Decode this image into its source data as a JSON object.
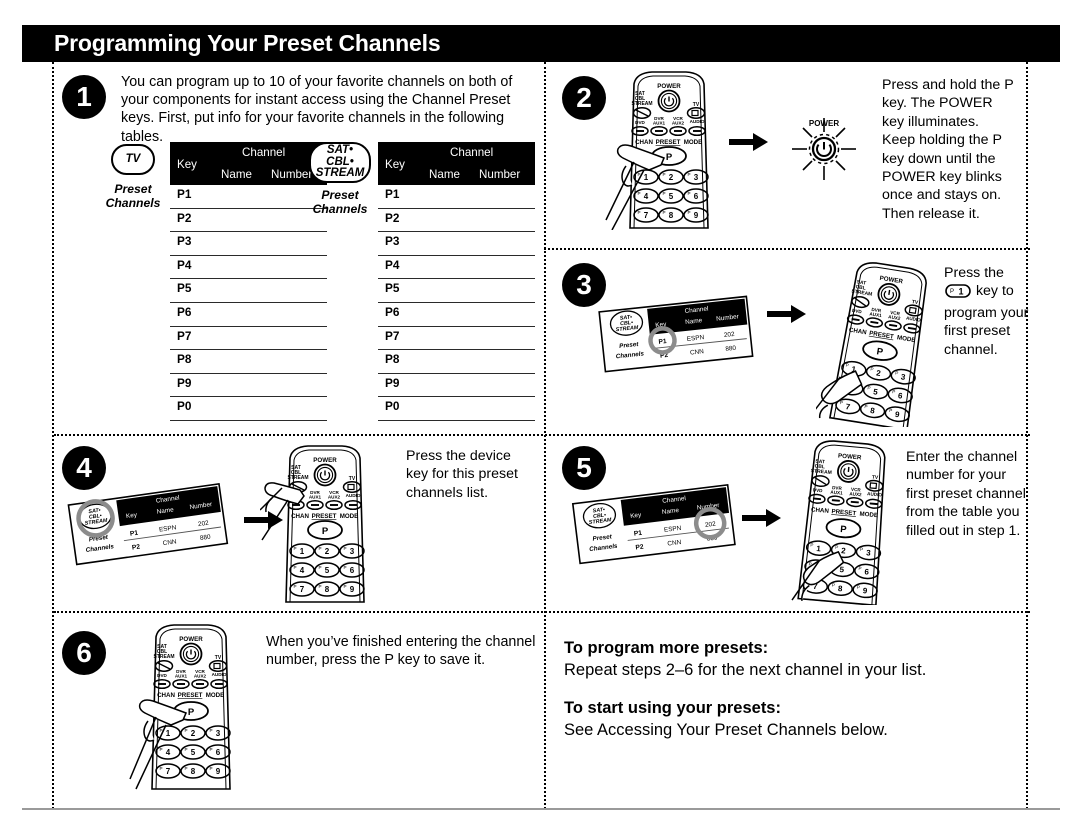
{
  "header": {
    "title": "Programming Your Preset Channels"
  },
  "steps": [
    {
      "number": "1",
      "text": "You can program up to 10 of your favorite channels on both of your components for instant access using the Channel Preset keys. First, put info for your favorite channels in the following tables."
    },
    {
      "number": "2",
      "text": "Press and hold the P key. The POWER key illuminates. Keep holding the P key down until the POWER key blinks once and stays on. Then release it."
    },
    {
      "number": "3",
      "text_before": "Press the",
      "key_glyph": "P1",
      "text_after": "key to program your first preset channel."
    },
    {
      "number": "4",
      "text": "Press the device key for this preset channels list."
    },
    {
      "number": "5",
      "text": "Enter the channel number for your first preset channel from the table you filled out in step 1."
    },
    {
      "number": "6",
      "text": "When you’ve finished entering the channel number, press the P key to save it."
    }
  ],
  "tables": {
    "columns": {
      "key": "Key",
      "channel": "Channel",
      "name": "Name",
      "number": "Number"
    },
    "preset_label_line1": "Preset",
    "preset_label_line2": "Channels",
    "rows": [
      "P1",
      "P2",
      "P3",
      "P4",
      "P5",
      "P6",
      "P7",
      "P8",
      "P9",
      "P0"
    ],
    "tv": {
      "device": "TV"
    },
    "sat": {
      "device_line1": "SAT•",
      "device_line2": "CBL•",
      "device_line3": "STREAM"
    }
  },
  "mini_table": {
    "device_line1": "SAT•",
    "device_line2": "CBL•",
    "device_line3": "STREAM",
    "preset_label_line1": "Preset",
    "preset_label_line2": "Channels",
    "col_key": "Key",
    "col_channel": "Channel",
    "col_name": "Name",
    "col_number": "Number",
    "rows": [
      {
        "key": "P1",
        "name": "ESPN",
        "number": "202"
      },
      {
        "key": "P2",
        "name": "CNN",
        "number": "880"
      }
    ]
  },
  "remote": {
    "power_label": "POWER",
    "device_sat_line1": "SAT",
    "device_sat_line2": "CBL",
    "device_sat_line3": "STREAM",
    "device_tv": "TV",
    "device_dvd": "DVD",
    "device_dvr": "DVR",
    "device_aux1": "AUX1",
    "device_vcr": "VCR",
    "device_aux2": "AUX2",
    "device_audio": "AUDIO",
    "row_chan": "CHAN",
    "row_preset": "PRESET",
    "row_mode": "MODE",
    "p_key": "P",
    "num_keys": [
      "1",
      "2",
      "3",
      "4",
      "5",
      "6",
      "7",
      "8",
      "9"
    ],
    "num_prefix": "P"
  },
  "blink": {
    "label": "POWER"
  },
  "notes": {
    "head1": "To program more presets:",
    "body1": "Repeat steps 2–6 for the next channel in your list.",
    "head2": "To start using your presets:",
    "body2": "See Accessing Your Preset Channels below."
  },
  "colors": {
    "ink": "#000000",
    "paper": "#ffffff",
    "rule": "#9a9a9a",
    "highlight_ring": "#8c8c8c"
  }
}
